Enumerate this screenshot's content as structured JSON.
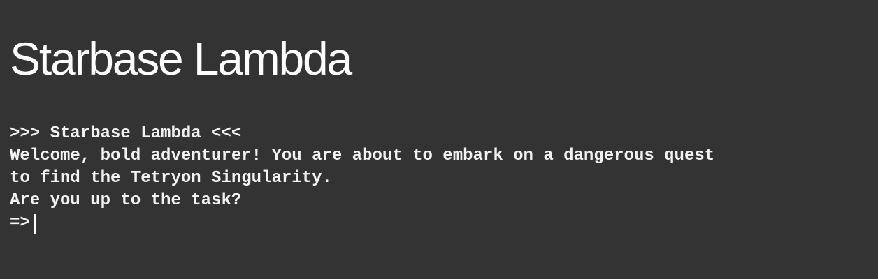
{
  "page": {
    "title": "Starbase Lambda"
  },
  "terminal": {
    "lines": [
      ">>> Starbase Lambda <<<",
      "Welcome, bold adventurer! You are about to embark on a dangerous quest",
      "to find the Tetryon Singularity.",
      "Are you up to the task?"
    ],
    "prompt": "=>",
    "input_value": ""
  },
  "colors": {
    "background": "#333333",
    "text": "#f2f2f2",
    "title": "#ffffff"
  }
}
